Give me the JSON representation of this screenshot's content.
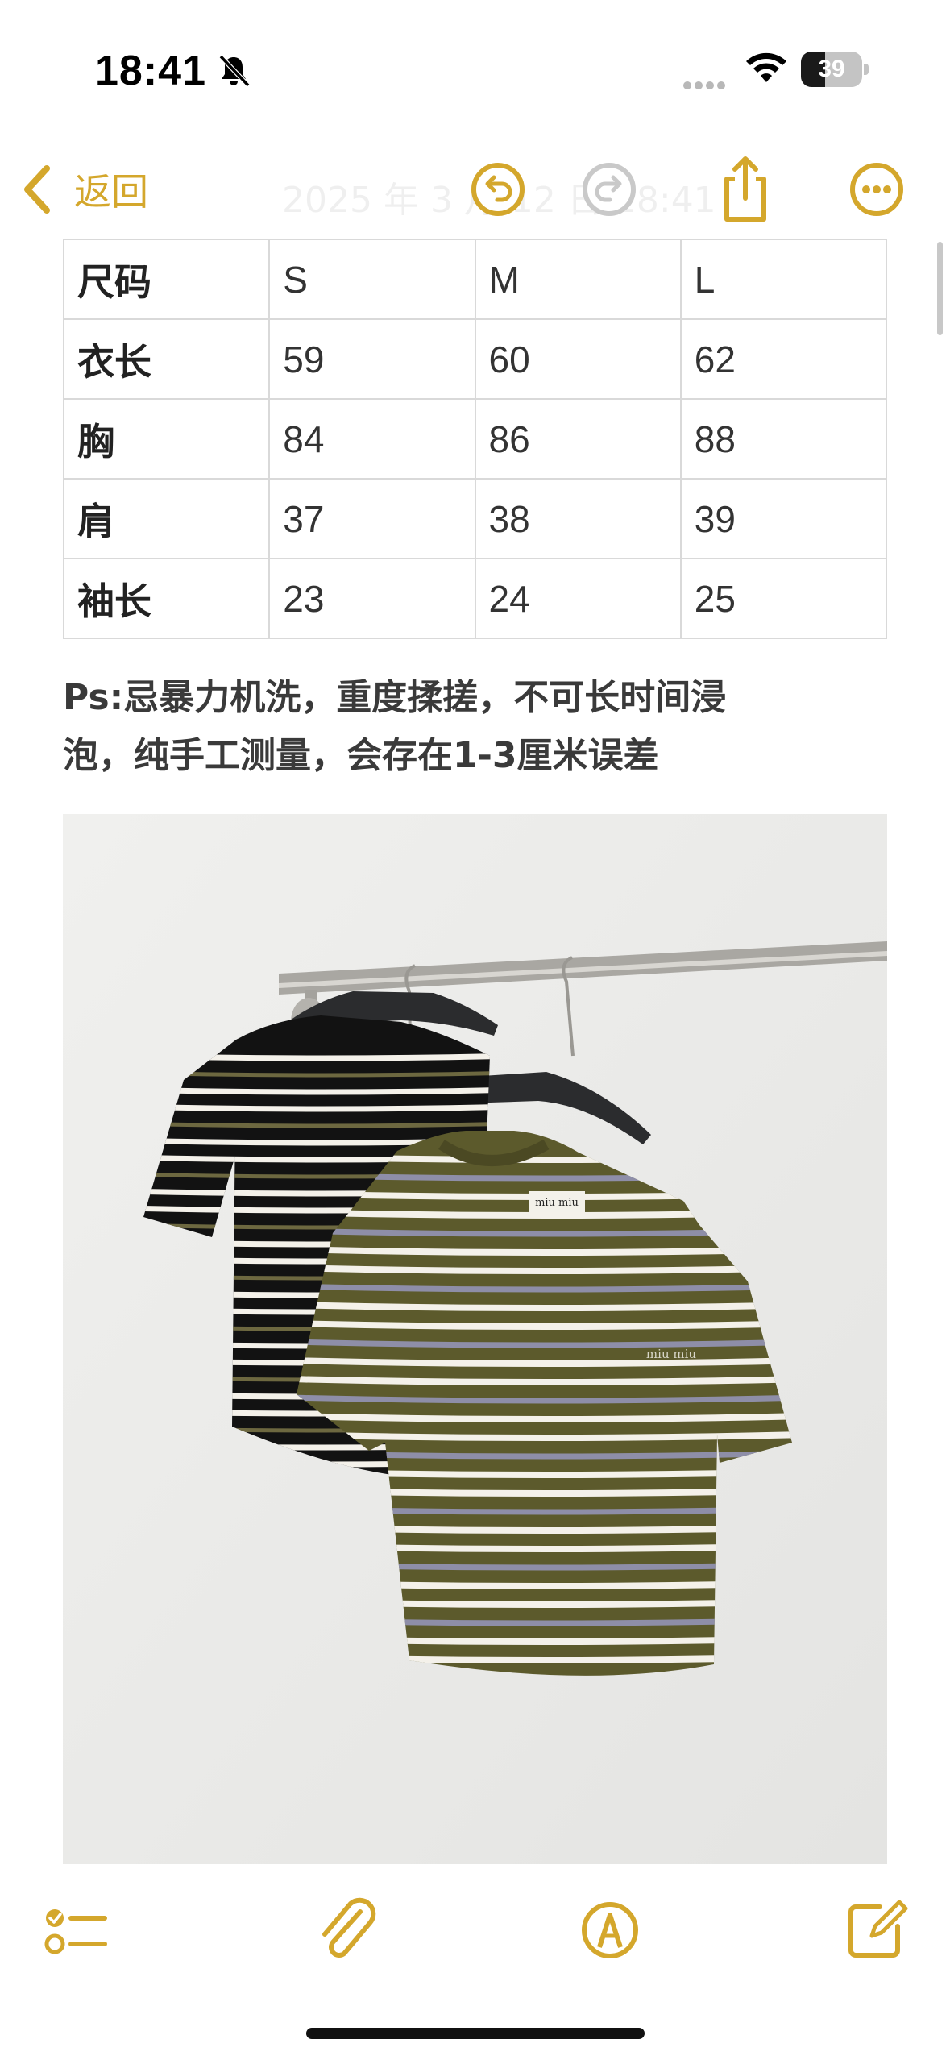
{
  "status": {
    "time": "18:41",
    "battery": "39",
    "battery_level": 0.39
  },
  "nav": {
    "back_label": "返回",
    "faded_title": "2025 年 3 月 12 日 18:41"
  },
  "size_table": {
    "rows": [
      [
        "尺码",
        "S",
        "M",
        "L"
      ],
      [
        "衣长",
        "59",
        "60",
        "62"
      ],
      [
        "胸",
        "84",
        "86",
        "88"
      ],
      [
        "肩",
        "37",
        "38",
        "39"
      ],
      [
        "袖长",
        "23",
        "24",
        "25"
      ]
    ]
  },
  "note": {
    "line1": "Ps:忌暴力机洗，重度揉搓，不可长时间浸",
    "line2": "泡，纯手工测量，会存在1-3厘米误差"
  },
  "photo": {
    "label_left": "miu miu",
    "label_chest": "miu miu"
  },
  "colors": {
    "accent": "#d4a72c",
    "olive_sweater": "#5c5a2c",
    "black_sweater": "#121212",
    "stripe_white": "#f4f1ea",
    "stripe_gray": "#8e8ea8"
  },
  "icons": [
    "bell-slash-icon",
    "signal-icon",
    "wifi-icon",
    "battery-icon",
    "back-chevron-icon",
    "undo-icon",
    "redo-icon",
    "share-icon",
    "more-icon",
    "checklist-icon",
    "paperclip-icon",
    "markup-pen-icon",
    "compose-icon"
  ]
}
